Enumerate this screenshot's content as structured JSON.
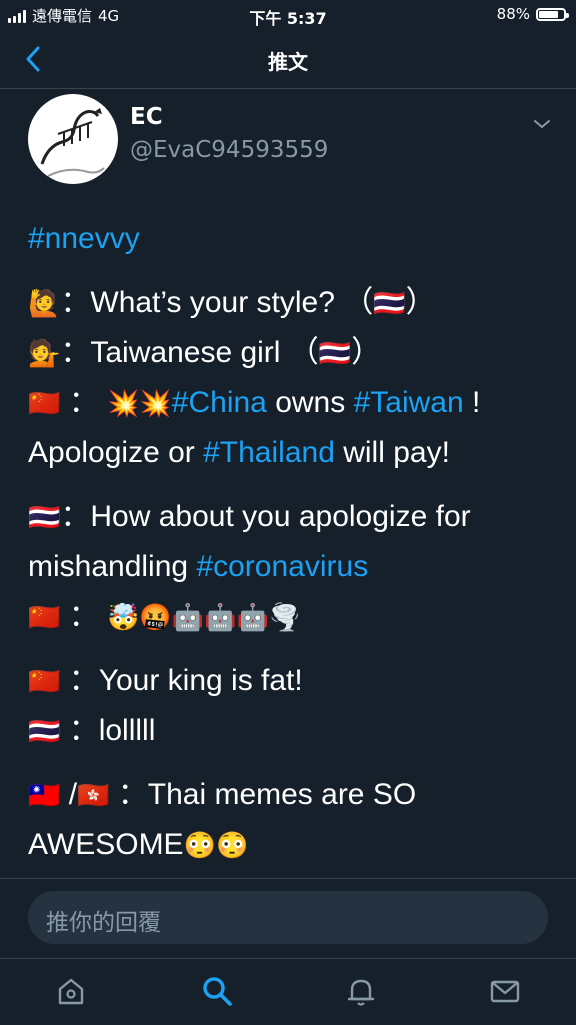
{
  "status_bar": {
    "carrier": "遠傳電信",
    "network": "4G",
    "time": "下午 5:37",
    "battery": "88%",
    "battery_level": 0.88
  },
  "nav": {
    "title": "推文",
    "back_icon": "chevron-left-icon"
  },
  "tweet": {
    "author_name": "EC",
    "author_handle": "@EvaC94593559",
    "lines": {
      "l1": {
        "tag": "#nnevvy"
      },
      "l2": {
        "emoji": "🙋",
        "text": "：What’s your style? （",
        "flag": "🇹🇭",
        "end": "）"
      },
      "l3": {
        "emoji": "💁",
        "text": "：Taiwanese girl （",
        "flag": "🇹🇭",
        "end": "）"
      },
      "l4": {
        "flag": "🇨🇳",
        "sep": " ： ",
        "emojis": "💥💥",
        "tag1": "#China",
        "mid": " owns ",
        "tag2": "#Taiwan",
        "end": " !"
      },
      "l5": {
        "pre": "Apologize or ",
        "tag": "#Thailand",
        "post": " will pay!"
      },
      "l6": {
        "flag": "🇹🇭",
        "text": "：How about you apologize for"
      },
      "l7": {
        "pre": "mishandling ",
        "tag": "#coronavirus"
      },
      "l8": {
        "flag": "🇨🇳",
        "sep": " ： ",
        "emojis": "🤯🤬🤖🤖🤖🌪️"
      },
      "l9": {
        "flag": "🇨🇳",
        "text": " ：Your king is fat!"
      },
      "l10": {
        "flag": "🇹🇭",
        "text": " ：lolllll"
      },
      "l11": {
        "flag1": "🇹🇼",
        "slash": " /",
        "flag2": "🇭🇰",
        "text": " ：Thai memes are SO"
      },
      "l12": {
        "text": "AWESOME",
        "emojis": "😳😳"
      }
    }
  },
  "reply": {
    "placeholder": "推你的回覆"
  },
  "tabs": [
    "home-icon",
    "search-icon",
    "bell-icon",
    "mail-icon"
  ],
  "colors": {
    "background": "#15202b",
    "accent": "#1da1f2",
    "muted": "#8899a6"
  }
}
